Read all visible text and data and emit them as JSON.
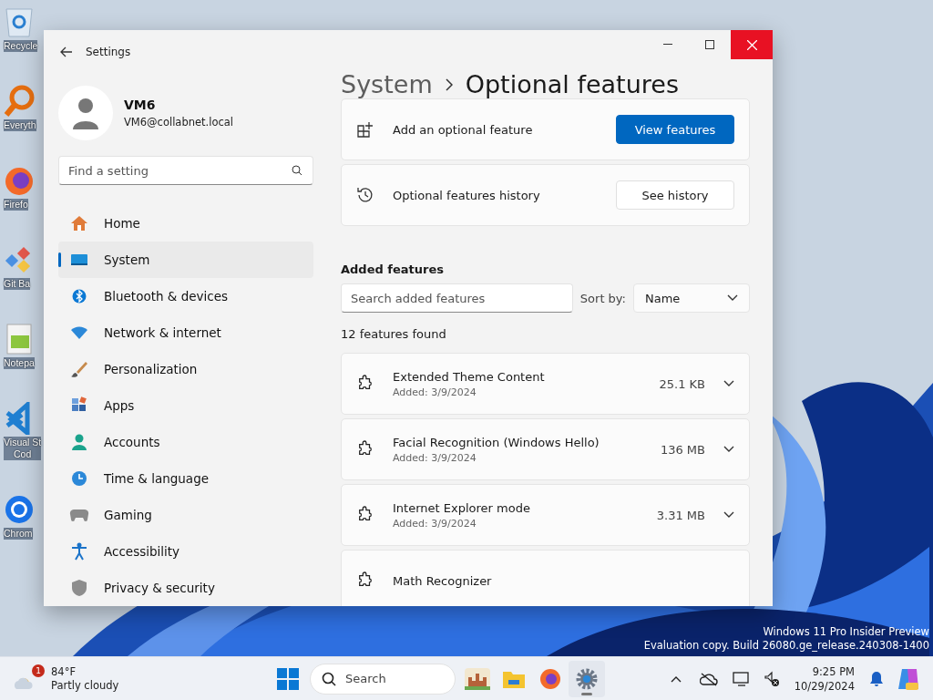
{
  "desktop_icons": [
    {
      "label": "Recycle"
    },
    {
      "label": "Everyth"
    },
    {
      "label": "Firefo"
    },
    {
      "label": "Git Ba"
    },
    {
      "label": "Notepa"
    },
    {
      "label": "Visual St\nCod"
    },
    {
      "label": "Chrom"
    }
  ],
  "window": {
    "title": "Settings"
  },
  "profile": {
    "name": "VM6",
    "email": "VM6@collabnet.local"
  },
  "search": {
    "placeholder": "Find a setting"
  },
  "nav": [
    {
      "label": "Home",
      "selected": false
    },
    {
      "label": "System",
      "selected": true
    },
    {
      "label": "Bluetooth & devices",
      "selected": false
    },
    {
      "label": "Network & internet",
      "selected": false
    },
    {
      "label": "Personalization",
      "selected": false
    },
    {
      "label": "Apps",
      "selected": false
    },
    {
      "label": "Accounts",
      "selected": false
    },
    {
      "label": "Time & language",
      "selected": false
    },
    {
      "label": "Gaming",
      "selected": false
    },
    {
      "label": "Accessibility",
      "selected": false
    },
    {
      "label": "Privacy & security",
      "selected": false
    }
  ],
  "breadcrumb": {
    "parent": "System",
    "current": "Optional features"
  },
  "actions": [
    {
      "label": "Add an optional feature",
      "button": "View features",
      "kind": "primary"
    },
    {
      "label": "Optional features history",
      "button": "See history",
      "kind": "secondary"
    }
  ],
  "added": {
    "heading": "Added features",
    "search_placeholder": "Search added features",
    "sort_label": "Sort by:",
    "sort_value": "Name",
    "count": "12 features found",
    "features": [
      {
        "name": "Extended Theme Content",
        "added": "Added: 3/9/2024",
        "size": "25.1 KB"
      },
      {
        "name": "Facial Recognition (Windows Hello)",
        "added": "Added: 3/9/2024",
        "size": "136 MB"
      },
      {
        "name": "Internet Explorer mode",
        "added": "Added: 3/9/2024",
        "size": "3.31 MB"
      },
      {
        "name": "Math Recognizer"
      }
    ]
  },
  "watermark": [
    "Windows 11 Pro Insider Preview",
    "Evaluation copy. Build 26080.ge_release.240308-1400"
  ],
  "taskbar": {
    "weather": {
      "badge": "1",
      "temp": "84°F",
      "condition": "Partly cloudy"
    },
    "search": "Search",
    "apps": [
      {
        "kind": "gallery",
        "active": false
      },
      {
        "kind": "folder",
        "active": false
      },
      {
        "kind": "browser",
        "active": false
      },
      {
        "kind": "settings",
        "active": true
      }
    ],
    "clock": {
      "time": "9:25 PM",
      "date": "10/29/2024"
    }
  }
}
